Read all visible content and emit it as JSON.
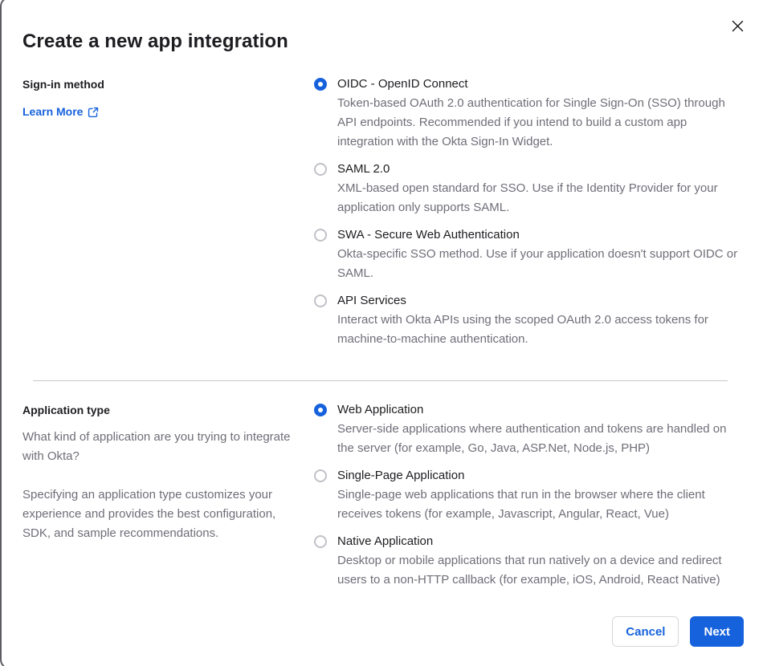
{
  "dialog": {
    "title": "Create a new app integration"
  },
  "signin_section": {
    "label": "Sign-in method",
    "learn_more_label": "Learn More",
    "options": [
      {
        "label": "OIDC - OpenID Connect",
        "description": "Token-based OAuth 2.0 authentication for Single Sign-On (SSO) through API endpoints. Recommended if you intend to build a custom app integration with the Okta Sign-In Widget.",
        "selected": true
      },
      {
        "label": "SAML 2.0",
        "description": "XML-based open standard for SSO. Use if the Identity Provider for your application only supports SAML.",
        "selected": false
      },
      {
        "label": "SWA - Secure Web Authentication",
        "description": "Okta-specific SSO method. Use if your application doesn't support OIDC or SAML.",
        "selected": false
      },
      {
        "label": "API Services",
        "description": "Interact with Okta APIs using the scoped OAuth 2.0 access tokens for machine-to-machine authentication.",
        "selected": false
      }
    ]
  },
  "apptype_section": {
    "label": "Application type",
    "description_1": "What kind of application are you trying to integrate with Okta?",
    "description_2": "Specifying an application type customizes your experience and provides the best configuration, SDK, and sample recommendations.",
    "options": [
      {
        "label": "Web Application",
        "description": "Server-side applications where authentication and tokens are handled on the server (for example, Go, Java, ASP.Net, Node.js, PHP)",
        "selected": true
      },
      {
        "label": "Single-Page Application",
        "description": "Single-page web applications that run in the browser where the client receives tokens (for example, Javascript, Angular, React, Vue)",
        "selected": false
      },
      {
        "label": "Native Application",
        "description": "Desktop or mobile applications that run natively on a device and redirect users to a non-HTTP callback (for example, iOS, Android, React Native)",
        "selected": false
      }
    ]
  },
  "footer": {
    "cancel_label": "Cancel",
    "next_label": "Next"
  },
  "colors": {
    "accent_blue": "#1662dd",
    "text_dark": "#1d1d21",
    "text_muted": "#6e6e78",
    "divider": "#c8c8ce",
    "radio_unselected_border": "#c1c1c8",
    "frame_border": "#5c5c61",
    "cancel_border": "#d7d7dc"
  }
}
